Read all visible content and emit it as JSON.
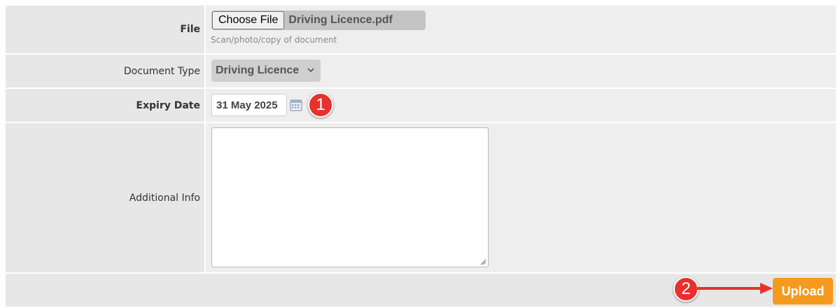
{
  "file": {
    "label": "File",
    "button_label": "Choose File",
    "file_name": "Driving Licence.pdf",
    "hint": "Scan/photo/copy of document"
  },
  "document_type": {
    "label": "Document Type",
    "selected": "Driving Licence",
    "icon": "chevron-down-icon"
  },
  "expiry_date": {
    "label": "Expiry Date",
    "value": "31 May 2025",
    "icon": "calendar-icon"
  },
  "additional_info": {
    "label": "Additional Info",
    "value": ""
  },
  "actions": {
    "upload_label": "Upload"
  },
  "annotations": {
    "callout_1": "1",
    "callout_2": "2"
  },
  "colors": {
    "upload_button": "#f59a1f",
    "callout": "#e8302d",
    "arrow": "#e8302d"
  }
}
